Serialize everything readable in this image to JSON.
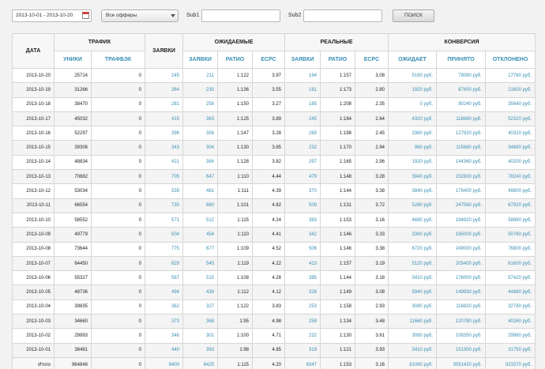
{
  "filters": {
    "date_range": "2013-10-01 - 2013-10-20",
    "offer_select": "Все офферы",
    "sub1_label": "Sub1",
    "sub1_value": "",
    "sub2_label": "Sub2",
    "sub2_value": "",
    "search_button": "ПОИСК"
  },
  "table": {
    "group_headers": {
      "date": "ДАТА",
      "traffic": "ТРАФИК",
      "leads": "ЗАЯВКИ",
      "expected": "ОЖИДАЕМЫЕ",
      "real": "РЕАЛЬНЫЕ",
      "conversion": "КОНВЕРСИЯ"
    },
    "sub_headers": {
      "uniques": "УНИКИ",
      "trafficback": "ТРАФБЭК",
      "exp_leads": "ЗАЯВКИ",
      "exp_ratio": "РАТИО",
      "exp_ecpc": "ECPC",
      "real_leads": "ЗАЯВКИ",
      "real_ratio": "РАТИО",
      "real_ecpc": "ECPC",
      "conv_expected": "ОЖИДАЕТ",
      "conv_accepted": "ПРИНЯТО",
      "conv_rejected": "ОТКЛОНЕНО"
    },
    "rows": [
      [
        "2013-10-20",
        "25714",
        "0",
        "245",
        "211",
        "1:122",
        "3.97",
        "164",
        "1:157",
        "3.08",
        "5160 руб.",
        "79080 руб.",
        "17760 руб."
      ],
      [
        "2013-10-19",
        "31266",
        "0",
        "264",
        "230",
        "1:136",
        "3.55",
        "181",
        "1:173",
        "2.80",
        "1920 руб.",
        "87600 руб.",
        "21600 руб."
      ],
      [
        "2013-10-18",
        "38470",
        "0",
        "281",
        "258",
        "1:150",
        "3.27",
        "185",
        "1:208",
        "2.35",
        "0 руб.",
        "90240 руб.",
        "35640 руб."
      ],
      [
        "2013-10-17",
        "45032",
        "0",
        "415",
        "363",
        "1:125",
        "3.89",
        "245",
        "1:184",
        "2.64",
        "4320 руб.",
        "118680 руб.",
        "52320 руб."
      ],
      [
        "2013-10-16",
        "52297",
        "0",
        "396",
        "356",
        "1:147",
        "3.28",
        "265",
        "1:198",
        "2.45",
        "3360 руб.",
        "127920 руб.",
        "40320 руб."
      ],
      [
        "2013-10-15",
        "39306",
        "0",
        "343",
        "304",
        "1:130",
        "3.85",
        "232",
        "1:170",
        "2.94",
        "960 руб.",
        "115680 руб.",
        "34680 руб."
      ],
      [
        "2013-10-14",
        "48834",
        "0",
        "421",
        "384",
        "1:128",
        "3.82",
        "297",
        "1:165",
        "2.96",
        "1920 руб.",
        "144360 руб.",
        "40200 руб."
      ],
      [
        "2013-10-13",
        "70882",
        "0",
        "705",
        "647",
        "1:110",
        "4.44",
        "479",
        "1:148",
        "3.28",
        "3840 руб.",
        "232800 руб.",
        "78240 руб."
      ],
      [
        "2013-10-12",
        "53034",
        "0",
        "539",
        "481",
        "1:111",
        "4.39",
        "370",
        "1:144",
        "3.38",
        "3840 руб.",
        "179400 руб.",
        "49800 руб."
      ],
      [
        "2013-10-11",
        "66554",
        "0",
        "730",
        "660",
        "1:101",
        "4.82",
        "509",
        "1:131",
        "3.72",
        "5280 руб.",
        "247560 руб.",
        "67920 руб."
      ],
      [
        "2013-10-10",
        "58552",
        "0",
        "571",
        "512",
        "1:115",
        "4.24",
        "383",
        "1:153",
        "3.16",
        "4680 руб.",
        "184920 руб.",
        "58680 руб."
      ],
      [
        "2013-10-09",
        "49779",
        "0",
        "504",
        "454",
        "1:110",
        "4.41",
        "342",
        "1:146",
        "3.33",
        "3360 руб.",
        "165000 руб.",
        "50760 руб."
      ],
      [
        "2013-10-08",
        "73644",
        "0",
        "775",
        "677",
        "1:109",
        "4.52",
        "506",
        "1:146",
        "3.38",
        "6720 руб.",
        "249000 руб.",
        "76800 руб."
      ],
      [
        "2013-10-07",
        "64450",
        "0",
        "629",
        "545",
        "1:119",
        "4.22",
        "413",
        "1:157",
        "3.19",
        "5120 руб.",
        "205400 руб.",
        "61600 руб."
      ],
      [
        "2013-10-06",
        "55327",
        "0",
        "567",
        "515",
        "1:108",
        "4.28",
        "385",
        "1:144",
        "3.18",
        "3410 руб.",
        "176000 руб.",
        "57420 руб."
      ],
      [
        "2013-10-05",
        "48736",
        "0",
        "494",
        "439",
        "1:112",
        "4.12",
        "328",
        "1:149",
        "3.08",
        "5940 руб.",
        "149930 руб.",
        "44880 руб."
      ],
      [
        "2013-10-04",
        "39835",
        "0",
        "362",
        "327",
        "1:122",
        "3.83",
        "253",
        "1:158",
        "2.93",
        "3080 руб.",
        "116820 руб.",
        "32780 руб."
      ],
      [
        "2013-10-03",
        "34660",
        "0",
        "373",
        "368",
        "1:95",
        "4.98",
        "259",
        "1:134",
        "3.48",
        "11660 руб.",
        "120780 руб.",
        "40260 руб."
      ],
      [
        "2013-10-02",
        "29993",
        "0",
        "346",
        "301",
        "1:100",
        "4.71",
        "232",
        "1:130",
        "3.61",
        "3080 руб.",
        "108350 руб.",
        "29960 руб."
      ],
      [
        "2013-10-01",
        "38481",
        "0",
        "440",
        "393",
        "1:98",
        "4.85",
        "319",
        "1:121",
        "3.93",
        "3410 руб.",
        "151300 руб.",
        "31750 руб."
      ]
    ],
    "total": [
      "Итого",
      "964846",
      "0",
      "9400",
      "8425",
      "1:115",
      "4.20",
      "6347",
      "1:153",
      "3.16",
      "81060 руб.",
      "3051420 руб.",
      "923370 руб."
    ]
  }
}
